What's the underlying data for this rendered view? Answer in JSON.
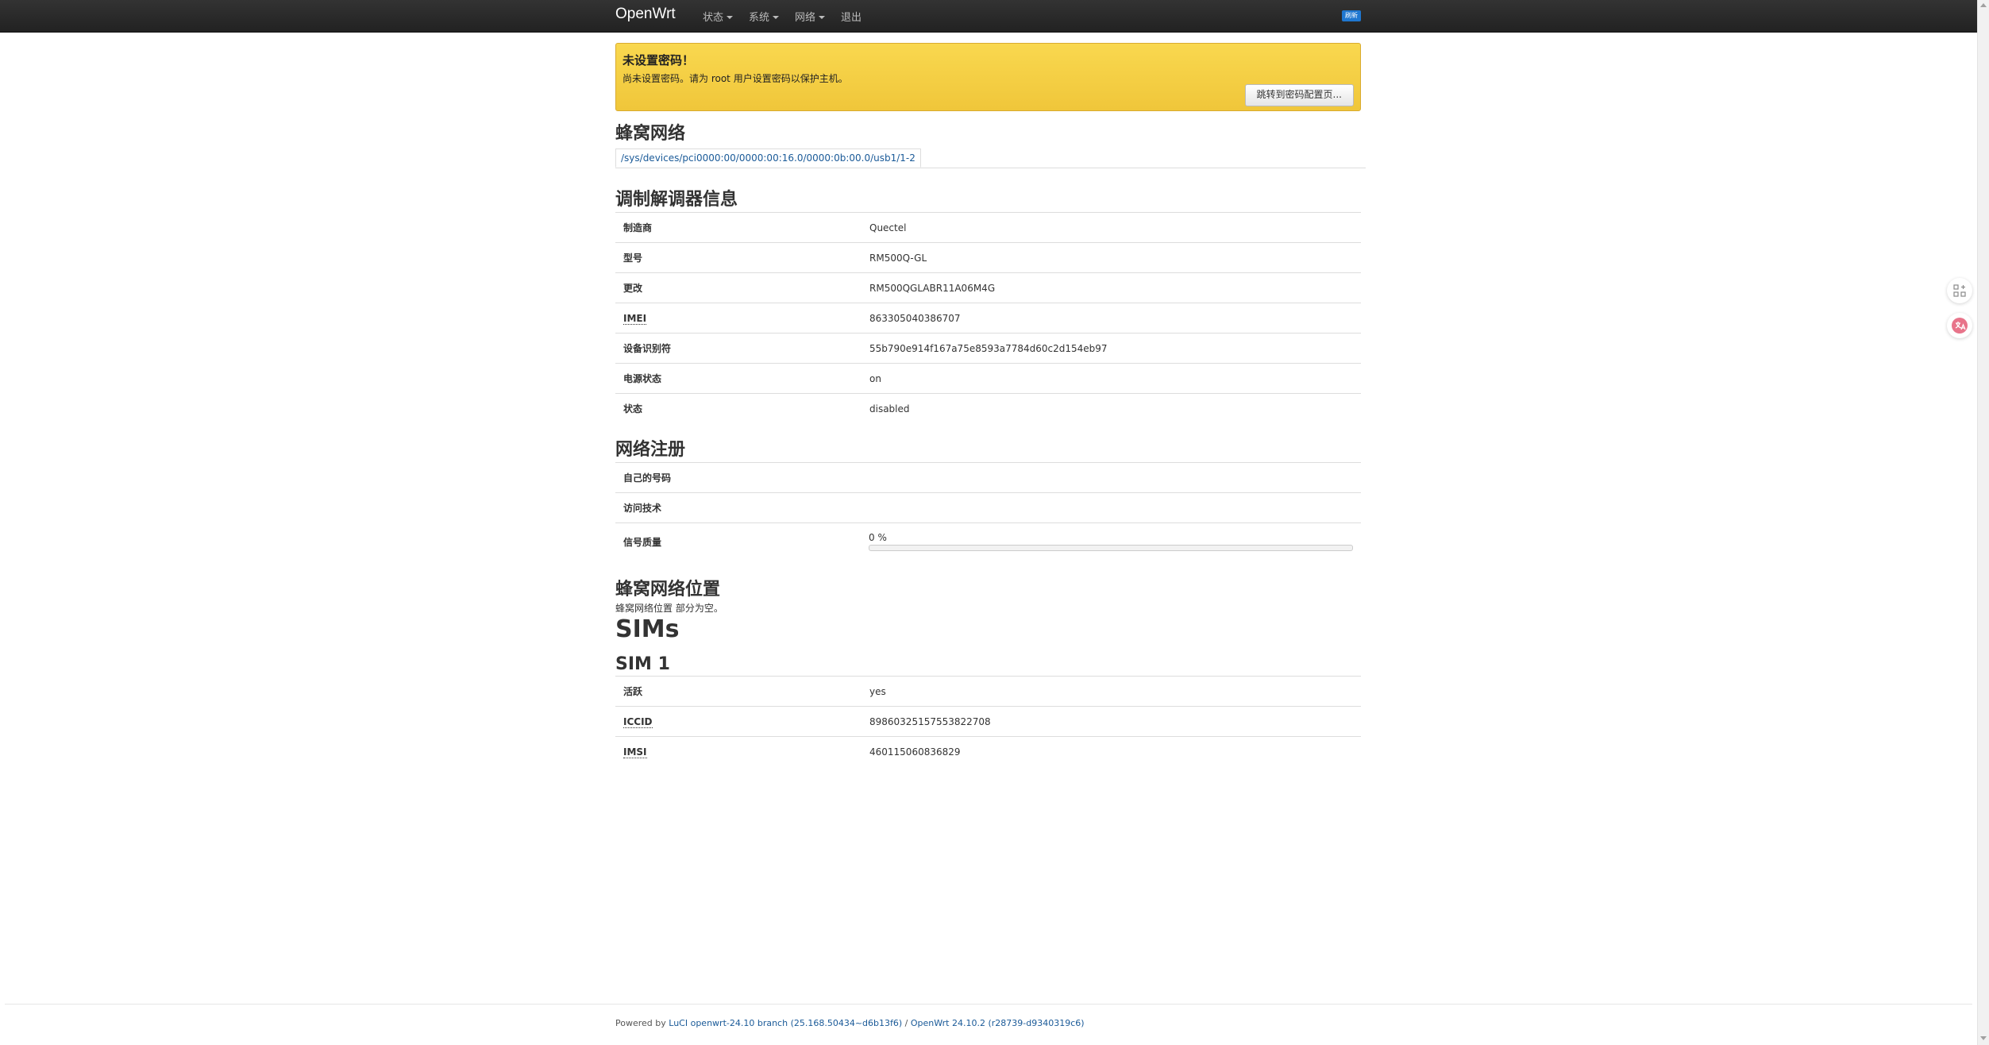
{
  "nav": {
    "brand": "OpenWrt",
    "menu": [
      {
        "label": "状态"
      },
      {
        "label": "系统"
      },
      {
        "label": "网络"
      },
      {
        "label": "退出"
      }
    ],
    "badge_label": "刷新"
  },
  "alert": {
    "title": "未设置密码！",
    "text": "尚未设置密码。请为 root 用户设置密码以保护主机。",
    "button": "跳转到密码配置页..."
  },
  "cellular": {
    "title": "蜂窝网络",
    "tab": "/sys/devices/pci0000:00/0000:00:16.0/0000:0b:00.0/usb1/1-2"
  },
  "modem": {
    "title": "调制解调器信息",
    "rows": [
      {
        "key": "制造商",
        "value": "Quectel"
      },
      {
        "key": "型号",
        "value": "RM500Q-GL"
      },
      {
        "key": "更改",
        "value": "RM500QGLABR11A06M4G"
      },
      {
        "key": "IMEI",
        "value": "863305040386707"
      },
      {
        "key": "设备识别符",
        "value": "55b790e914f167a75e8593a7784d60c2d154eb97"
      },
      {
        "key": "电源状态",
        "value": "on"
      },
      {
        "key": "状态",
        "value": "disabled"
      }
    ]
  },
  "registration": {
    "title": "网络注册",
    "own_number_label": "自己的号码",
    "own_number_value": "",
    "access_tech_label": "访问技术",
    "access_tech_value": "",
    "signal_label": "信号质量",
    "signal_text": "0 %",
    "signal_percent": 0
  },
  "location": {
    "title": "蜂窝网络位置",
    "note": "蜂窝网络位置 部分为空。"
  },
  "sims": {
    "title": "SIMs",
    "sim1": {
      "title": "SIM 1",
      "rows": [
        {
          "key": "活跃",
          "value": "yes"
        },
        {
          "key": "ICCID",
          "value": "89860325157553822708"
        },
        {
          "key": "IMSI",
          "value": "460115060836829"
        }
      ]
    }
  },
  "footer": {
    "prefix": "Powered by ",
    "luci_link": "LuCI openwrt-24.10 branch (25.168.50434~d6b13f6)",
    "separator": " / ",
    "openwrt_link": "OpenWrt 24.10.2 (r28739-d9340319c6)"
  },
  "colors": {
    "navbar": "#222222",
    "alert": "#f0c63a",
    "link": "#1a5a98"
  },
  "icons": [
    "caret-down-icon",
    "grid-add-icon",
    "translate-icon"
  ]
}
